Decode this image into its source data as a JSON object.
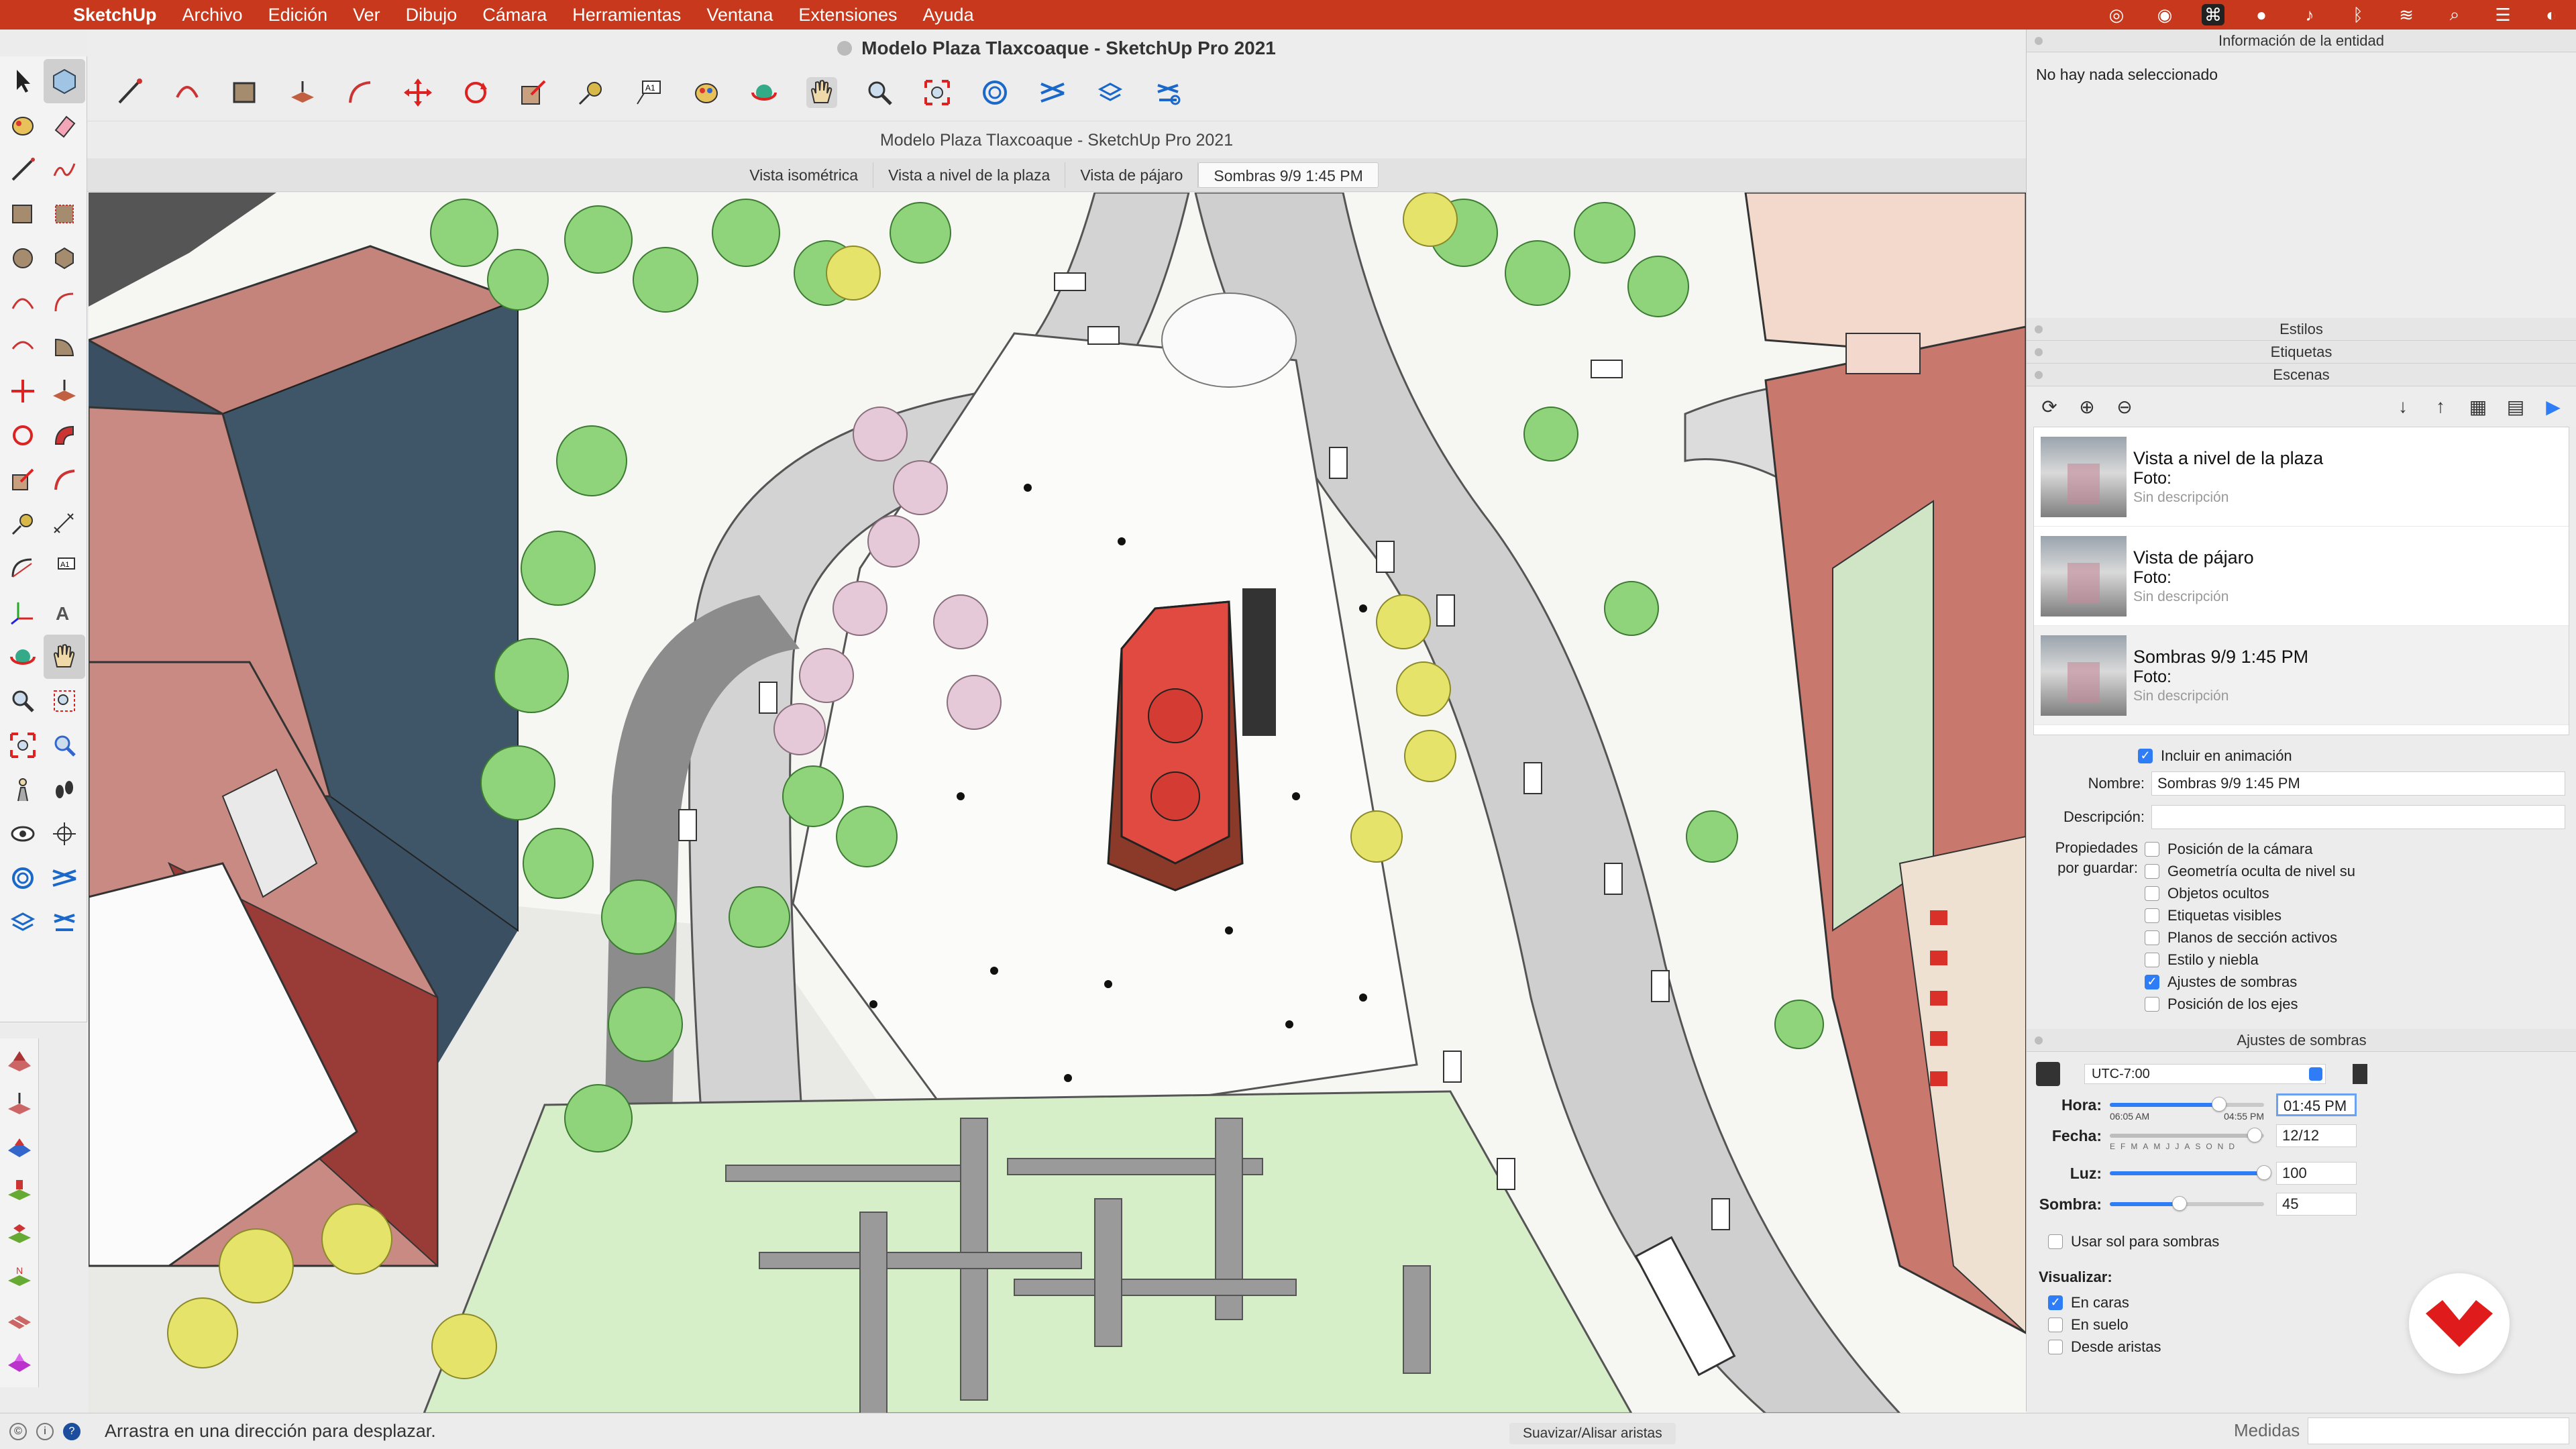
{
  "menubar": {
    "app_name": "SketchUp",
    "items": [
      "Archivo",
      "Edición",
      "Ver",
      "Dibujo",
      "Cámara",
      "Herramientas",
      "Ventana",
      "Extensiones",
      "Ayuda"
    ]
  },
  "window": {
    "title": "Modelo Plaza Tlaxcoaque - SketchUp Pro 2021",
    "subtitle": "Modelo Plaza Tlaxcoaque - SketchUp Pro 2021"
  },
  "scene_tabs": [
    "Vista isométrica",
    "Vista a nivel de la plaza",
    "Vista de pájaro",
    "Sombras 9/9 1:45 PM"
  ],
  "active_scene_tab": 3,
  "tray": {
    "entity_info": {
      "title": "Información de la entidad",
      "message": "No hay nada seleccionado"
    },
    "styles_title": "Estilos",
    "tags_title": "Etiquetas",
    "scenes_title": "Escenas",
    "scene_list": [
      {
        "name": "Vista a nivel de la plaza",
        "photo": "Foto:",
        "desc": "Sin descripción"
      },
      {
        "name": "Vista de pájaro",
        "photo": "Foto:",
        "desc": "Sin descripción"
      },
      {
        "name": "Sombras 9/9 1:45 PM",
        "photo": "Foto:",
        "desc": "Sin descripción"
      }
    ],
    "include_animation": "Incluir en animación",
    "name_label": "Nombre:",
    "name_value": "Sombras 9/9 1:45 PM",
    "desc_label": "Descripción:",
    "props_label_1": "Propiedades",
    "props_label_2": "por guardar:",
    "properties": [
      {
        "label": "Posición de la cámara",
        "checked": false
      },
      {
        "label": "Geometría oculta de nivel su",
        "checked": false
      },
      {
        "label": "Objetos ocultos",
        "checked": false
      },
      {
        "label": "Etiquetas visibles",
        "checked": false
      },
      {
        "label": "Planos de sección activos",
        "checked": false
      },
      {
        "label": "Estilo y niebla",
        "checked": false
      },
      {
        "label": "Ajustes de sombras",
        "checked": true
      },
      {
        "label": "Posición de los ejes",
        "checked": false
      }
    ],
    "shadows": {
      "title": "Ajustes de sombras",
      "timezone": "UTC-7:00",
      "time_label": "Hora:",
      "sunrise": "06:05 AM",
      "sunset": "04:55 PM",
      "time_value": "01:45 PM",
      "time_fraction": 0.71,
      "date_label": "Fecha:",
      "months": "EFMAMJJASOND",
      "date_value": "12/12",
      "date_fraction": 0.94,
      "light_label": "Luz:",
      "light_value": "100",
      "shadow_label": "Sombra:",
      "shadow_value": "45",
      "use_sun": "Usar sol para sombras",
      "visualize_label": "Visualizar:",
      "on_faces": "En caras",
      "on_ground": "En suelo",
      "from_edges": "Desde aristas"
    }
  },
  "status": {
    "message": "Arrastra en una dirección para desplazar.",
    "smooth_button": "Suavizar/Alisar aristas",
    "measures_label": "Medidas"
  },
  "colors": {
    "menubar": "#c8381c",
    "accent": "#2f7df6",
    "church_red": "#e04a40",
    "building_pink": "#c88a82",
    "tree_green": "#8fd47a",
    "blossom_pink": "#e6c9d8",
    "logo_red": "#e01b1b"
  },
  "icons": [
    "apple-icon",
    "select-icon",
    "pencil-icon",
    "orbit-icon",
    "pan-hand-icon",
    "zoom-icon",
    "move-icon",
    "rotate-icon",
    "search-icon",
    "wifi-icon",
    "bluetooth-icon"
  ]
}
